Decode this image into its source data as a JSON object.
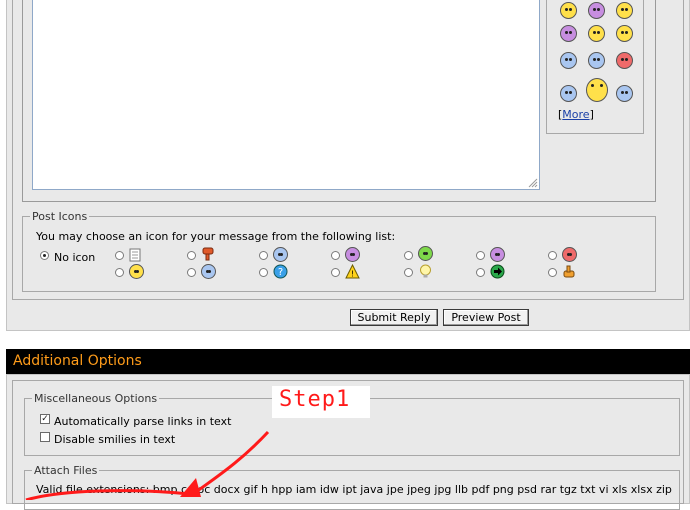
{
  "smilies": {
    "more_link": "More",
    "items": [
      "eek",
      "purple-grin",
      "yellow-smile",
      "purple-frown",
      "yellow-laugh",
      "yellow-wink",
      "confused",
      "blue-shocked",
      "red-mad",
      "blue-roll",
      "big-grin",
      "blue-cool"
    ]
  },
  "post_icons": {
    "legend": "Post Icons",
    "description": "You may choose an icon for your message from the following list:",
    "no_icon_label": "No icon",
    "selected": "no-icon",
    "icons": [
      "document-icon",
      "thumbs-down-icon",
      "smile-icon",
      "purple-smile-icon",
      "grin-icon",
      "angry-purple-icon",
      "red-frown-icon",
      "yellow-smile-icon",
      "cool-icon",
      "question-icon",
      "warning-icon",
      "lightbulb-icon",
      "arrow-right-icon",
      "thumbs-up-icon"
    ]
  },
  "buttons": {
    "submit_reply": "Submit Reply",
    "preview_post": "Preview Post"
  },
  "additional_options": {
    "title": "Additional Options",
    "misc": {
      "legend": "Miscellaneous Options",
      "parse_links_label": "Automatically parse links in text",
      "parse_links_checked": true,
      "disable_smilies_label": "Disable smilies in text",
      "disable_smilies_checked": false
    },
    "attach": {
      "legend": "Attach Files",
      "valid_extensions": "Valid file extensions: bmp c doc docx gif h hpp iam idw ipt java jpe jpeg jpg llb pdf png psd rar tgz txt vi xls xlsx zip"
    }
  },
  "annotation": {
    "label": "Step1",
    "color": "#ff1a1a"
  },
  "colors": {
    "header_bg": "#000000",
    "header_text": "#ff9c1a",
    "panel_bg": "#e9e9e9"
  }
}
